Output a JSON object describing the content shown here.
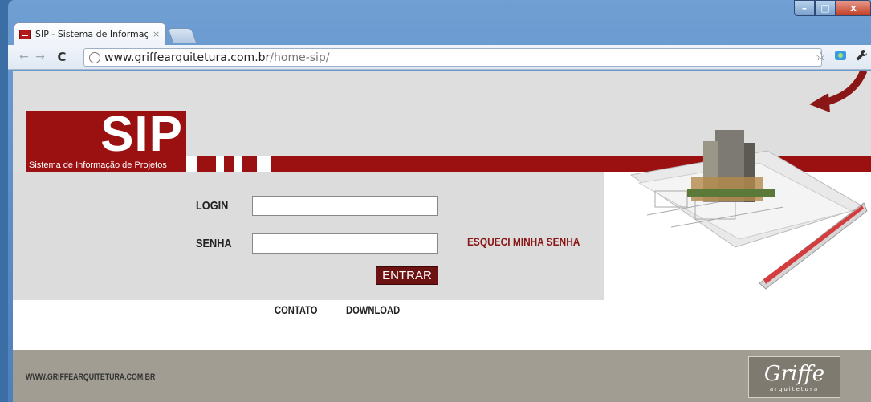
{
  "browser": {
    "tab_title": "SIP - Sistema de Informação",
    "tab_close": "×",
    "url_host": "www.griffearquitetura.com.br",
    "url_path": "/home-sip/",
    "back": "←",
    "forward": "→",
    "reload": "C",
    "star": "☆",
    "wrench": "🔧",
    "min": "–",
    "max": "□",
    "close": "x"
  },
  "logo": {
    "title": "SIP",
    "subtitle": "Sistema de Informação de Projetos"
  },
  "form": {
    "login_label": "LOGIN",
    "login_value": "",
    "password_label": "SENHA",
    "password_value": "",
    "forgot_label": "ESQUECI MINHA SENHA",
    "submit_label": "ENTRAR"
  },
  "nav": {
    "contact": "CONTATO",
    "download": "DOWNLOAD"
  },
  "footer": {
    "url": "WWW.GRIFFEARQUITETURA.COM.BR",
    "brand": "Griffe",
    "brand_sub": "arquitetura"
  },
  "colors": {
    "brand_red": "#9b1010",
    "button_red": "#6d1212",
    "footer": "#a29d92",
    "page_bg": "#dedede"
  }
}
